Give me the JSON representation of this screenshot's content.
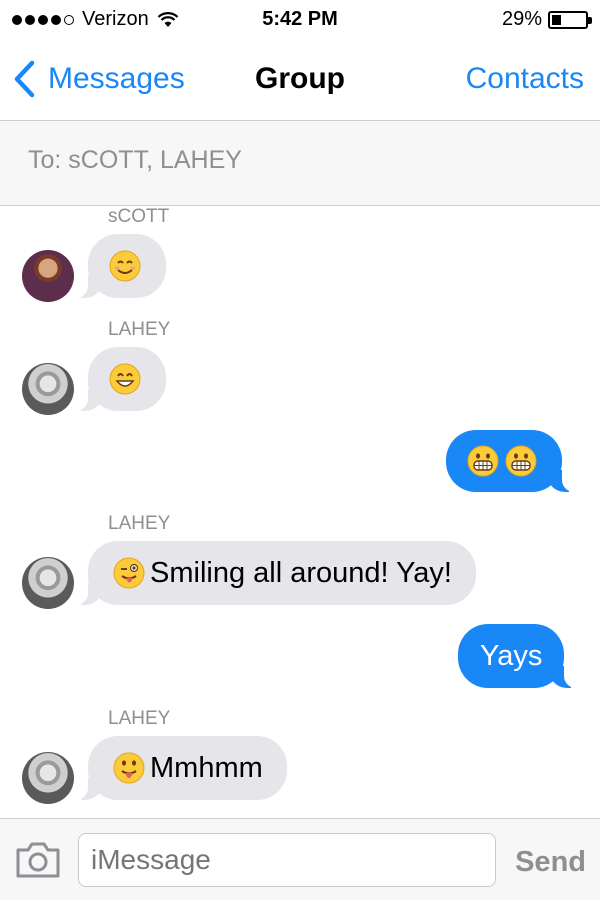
{
  "status_bar": {
    "carrier": "Verizon",
    "time": "5:42 PM",
    "battery_text": "29%",
    "battery_level": 0.29,
    "signal_bars": 4
  },
  "nav": {
    "back_label": "Messages",
    "title": "Group",
    "contacts_label": "Contacts"
  },
  "recipients": {
    "to_text": "To: sCOTT, LAHEY"
  },
  "messages": [
    {
      "sender": "sCOTT",
      "direction": "in",
      "emoji": "smiling-face-icon",
      "text": ""
    },
    {
      "sender": "LAHEY",
      "direction": "in",
      "emoji": "grinning-face-icon",
      "text": ""
    },
    {
      "sender": "",
      "direction": "out",
      "emoji": "grimacing-face-icon x2",
      "text": ""
    },
    {
      "sender": "LAHEY",
      "direction": "in",
      "emoji": "winking-tongue-face-icon",
      "text": "Smiling all around! Yay!"
    },
    {
      "sender": "",
      "direction": "out",
      "emoji": "",
      "text": "Yays"
    },
    {
      "sender": "LAHEY",
      "direction": "in",
      "emoji": "tongue-face-icon",
      "text": "Mmhmm"
    }
  ],
  "compose": {
    "placeholder": "iMessage",
    "send_label": "Send"
  },
  "colors": {
    "accent": "#1a87f6",
    "incoming_bubble": "#e5e5ea",
    "outgoing_bubble": "#1a87f6",
    "secondary_text": "#8e8e93"
  }
}
